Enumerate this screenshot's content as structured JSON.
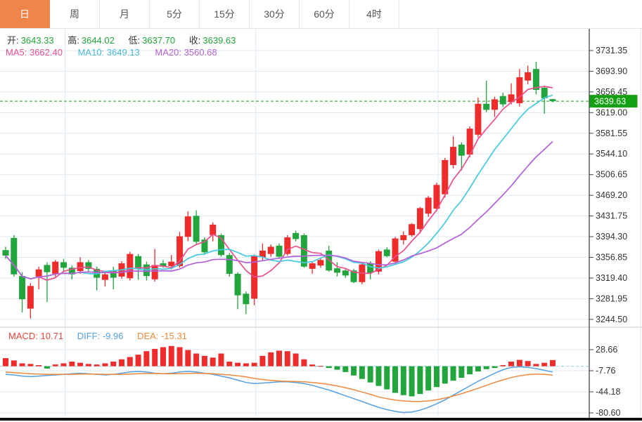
{
  "tabs": {
    "items": [
      {
        "label": "日",
        "active": true
      },
      {
        "label": "周",
        "active": false
      },
      {
        "label": "月",
        "active": false
      },
      {
        "label": "5分",
        "active": false
      },
      {
        "label": "15分",
        "active": false
      },
      {
        "label": "30分",
        "active": false
      },
      {
        "label": "60分",
        "active": false
      },
      {
        "label": "4时",
        "active": false
      }
    ]
  },
  "quote": {
    "open_label": "开:",
    "open": "3643.33",
    "high_label": "高:",
    "high": "3644.02",
    "low_label": "低:",
    "low": "3637.70",
    "close_label": "收:",
    "close": "3639.63"
  },
  "ma": {
    "ma5_label": "MA5:",
    "ma5": "3662.40",
    "ma10_label": "MA10:",
    "ma10": "3649.13",
    "ma20_label": "MA20:",
    "ma20": "3560.68"
  },
  "macd_info": {
    "macd_label": "MACD:",
    "macd": "10.71",
    "diff_label": "DIFF:",
    "diff": "-9.96",
    "dea_label": "DEA:",
    "dea": "-15.31"
  },
  "last_price_badge": "3639.63",
  "colors": {
    "up": "#ee2c2c",
    "down": "#22a53c",
    "ma5": "#ec4f8e",
    "ma10": "#45c9de",
    "ma20": "#b35fd8",
    "diff_line": "#56a0e0",
    "dea_line": "#f0883c",
    "grid": "#dde9f3",
    "axis_line": "#444444",
    "axis_text": "#333333",
    "badge_bg": "#13a113",
    "last_price_dash": "#18a018",
    "zero_dash": "#8fd8e8",
    "active_tab": "#f0854a"
  },
  "chart_data": {
    "type": "candlestick",
    "interval": "日",
    "panels": [
      "price",
      "macd"
    ],
    "legend": [
      "MA5",
      "MA10",
      "MA20"
    ],
    "ma_periods": [
      5,
      10,
      20
    ],
    "price_axis_ticks": [
      3731.35,
      3693.9,
      3656.45,
      3619.0,
      3581.55,
      3544.1,
      3506.65,
      3469.2,
      3431.75,
      3394.3,
      3356.85,
      3319.4,
      3281.95,
      3244.5
    ],
    "last_price": 3639.63,
    "month_boundary_indices": [
      7,
      30,
      52
    ],
    "candles": [
      [
        3370,
        3376,
        3354,
        3360
      ],
      [
        3392,
        3397,
        3322,
        3326
      ],
      [
        3323,
        3330,
        3257,
        3281
      ],
      [
        3264,
        3310,
        3246,
        3305
      ],
      [
        3322,
        3340,
        3299,
        3335
      ],
      [
        3343,
        3348,
        3276,
        3330
      ],
      [
        3327,
        3352,
        3322,
        3349
      ],
      [
        3348,
        3354,
        3331,
        3338
      ],
      [
        3338,
        3342,
        3317,
        3326
      ],
      [
        3332,
        3357,
        3327,
        3348
      ],
      [
        3348,
        3352,
        3330,
        3336
      ],
      [
        3336,
        3340,
        3297,
        3320
      ],
      [
        3316,
        3330,
        3304,
        3326
      ],
      [
        3333,
        3340,
        3299,
        3320
      ],
      [
        3322,
        3350,
        3318,
        3346
      ],
      [
        3319,
        3367,
        3315,
        3363
      ],
      [
        3359,
        3363,
        3316,
        3336
      ],
      [
        3344,
        3349,
        3315,
        3323
      ],
      [
        3317,
        3372,
        3313,
        3343
      ],
      [
        3346,
        3352,
        3338,
        3340
      ],
      [
        3341,
        3361,
        3335,
        3349
      ],
      [
        3341,
        3403,
        3338,
        3395
      ],
      [
        3394,
        3440,
        3386,
        3431
      ],
      [
        3432,
        3442,
        3380,
        3385
      ],
      [
        3389,
        3393,
        3361,
        3366
      ],
      [
        3397,
        3420,
        3386,
        3416
      ],
      [
        3397,
        3400,
        3358,
        3361
      ],
      [
        3361,
        3365,
        3322,
        3327
      ],
      [
        3327,
        3330,
        3263,
        3288
      ],
      [
        3291,
        3295,
        3254,
        3272
      ],
      [
        3282,
        3362,
        3270,
        3359
      ],
      [
        3357,
        3382,
        3352,
        3369
      ],
      [
        3363,
        3380,
        3358,
        3376
      ],
      [
        3378,
        3382,
        3356,
        3358
      ],
      [
        3363,
        3397,
        3360,
        3393
      ],
      [
        3401,
        3405,
        3386,
        3390
      ],
      [
        3397,
        3400,
        3338,
        3340
      ],
      [
        3336,
        3350,
        3327,
        3346
      ],
      [
        3342,
        3356,
        3338,
        3352
      ],
      [
        3369,
        3378,
        3331,
        3333
      ],
      [
        3337,
        3348,
        3322,
        3329
      ],
      [
        3333,
        3337,
        3320,
        3324
      ],
      [
        3333,
        3336,
        3310,
        3312
      ],
      [
        3312,
        3346,
        3308,
        3344
      ],
      [
        3346,
        3350,
        3317,
        3329
      ],
      [
        3331,
        3371,
        3326,
        3368
      ],
      [
        3371,
        3375,
        3357,
        3359
      ],
      [
        3349,
        3394,
        3345,
        3391
      ],
      [
        3388,
        3404,
        3380,
        3397
      ],
      [
        3397,
        3419,
        3394,
        3417
      ],
      [
        3408,
        3448,
        3400,
        3446
      ],
      [
        3436,
        3468,
        3430,
        3465
      ],
      [
        3445,
        3492,
        3440,
        3488
      ],
      [
        3471,
        3537,
        3465,
        3533
      ],
      [
        3524,
        3576,
        3518,
        3557
      ],
      [
        3561,
        3565,
        3514,
        3541
      ],
      [
        3543,
        3594,
        3538,
        3590
      ],
      [
        3579,
        3646,
        3574,
        3635
      ],
      [
        3635,
        3677,
        3620,
        3624
      ],
      [
        3624,
        3648,
        3611,
        3643
      ],
      [
        3649,
        3655,
        3629,
        3634
      ],
      [
        3638,
        3672,
        3634,
        3652
      ],
      [
        3636,
        3698,
        3630,
        3683
      ],
      [
        3677,
        3704,
        3670,
        3692
      ],
      [
        3698,
        3711,
        3652,
        3660
      ],
      [
        3664,
        3668,
        3617,
        3645
      ],
      [
        3643.33,
        3644.02,
        3637.7,
        3639.63
      ]
    ],
    "macd": {
      "axis_ticks": [
        28.66,
        -7.76,
        -44.18,
        -80.6
      ],
      "hist": [
        14,
        10,
        5,
        4,
        2,
        -4,
        3,
        5,
        8,
        6,
        4,
        3,
        5,
        8,
        12,
        16,
        20,
        26,
        30,
        33,
        35,
        33,
        28,
        22,
        18,
        15,
        22,
        8,
        6,
        5,
        6,
        18,
        24,
        27,
        26,
        22,
        12,
        3,
        0.5,
        -3,
        -6,
        -10,
        -16,
        -22,
        -28,
        -34,
        -40,
        -46,
        -50,
        -52,
        -48,
        -42,
        -36,
        -30,
        -25,
        -20,
        -14,
        -9,
        -5,
        -3,
        2,
        8,
        11,
        9,
        4,
        6,
        10.71
      ],
      "diff": [
        -14,
        -15,
        -17,
        -18,
        -17,
        -16,
        -15,
        -14,
        -13,
        -12,
        -13,
        -14,
        -15,
        -14,
        -12,
        -10,
        -9,
        -10,
        -12,
        -13,
        -12,
        -10,
        -9,
        -10,
        -12,
        -14,
        -17,
        -20,
        -24,
        -28,
        -30,
        -29,
        -28,
        -27,
        -27,
        -28,
        -30,
        -33,
        -37,
        -41,
        -46,
        -51,
        -56,
        -61,
        -66,
        -71,
        -75,
        -78,
        -80,
        -79,
        -76,
        -71,
        -65,
        -58,
        -50,
        -42,
        -34,
        -26,
        -19,
        -12,
        -6,
        -2,
        -1,
        -2,
        -4,
        -7,
        -9.96
      ],
      "dea": [
        -10,
        -11,
        -12,
        -13,
        -13.5,
        -14,
        -14,
        -14,
        -14,
        -13.5,
        -13.5,
        -13.5,
        -14,
        -14,
        -14,
        -13.5,
        -13,
        -12.5,
        -12.5,
        -13,
        -13,
        -13,
        -12.5,
        -12,
        -12.5,
        -13,
        -14,
        -15,
        -16.5,
        -18.5,
        -21,
        -23,
        -24.5,
        -25.5,
        -26,
        -26.5,
        -27,
        -28,
        -29.5,
        -31.5,
        -34,
        -37,
        -40.5,
        -44.5,
        -48.5,
        -53,
        -56,
        -58.5,
        -60,
        -61,
        -61,
        -60,
        -58,
        -55,
        -51.5,
        -47.5,
        -43,
        -38,
        -33,
        -28,
        -23.5,
        -19.5,
        -16.5,
        -14.5,
        -13.5,
        -14,
        -15.31
      ]
    }
  }
}
